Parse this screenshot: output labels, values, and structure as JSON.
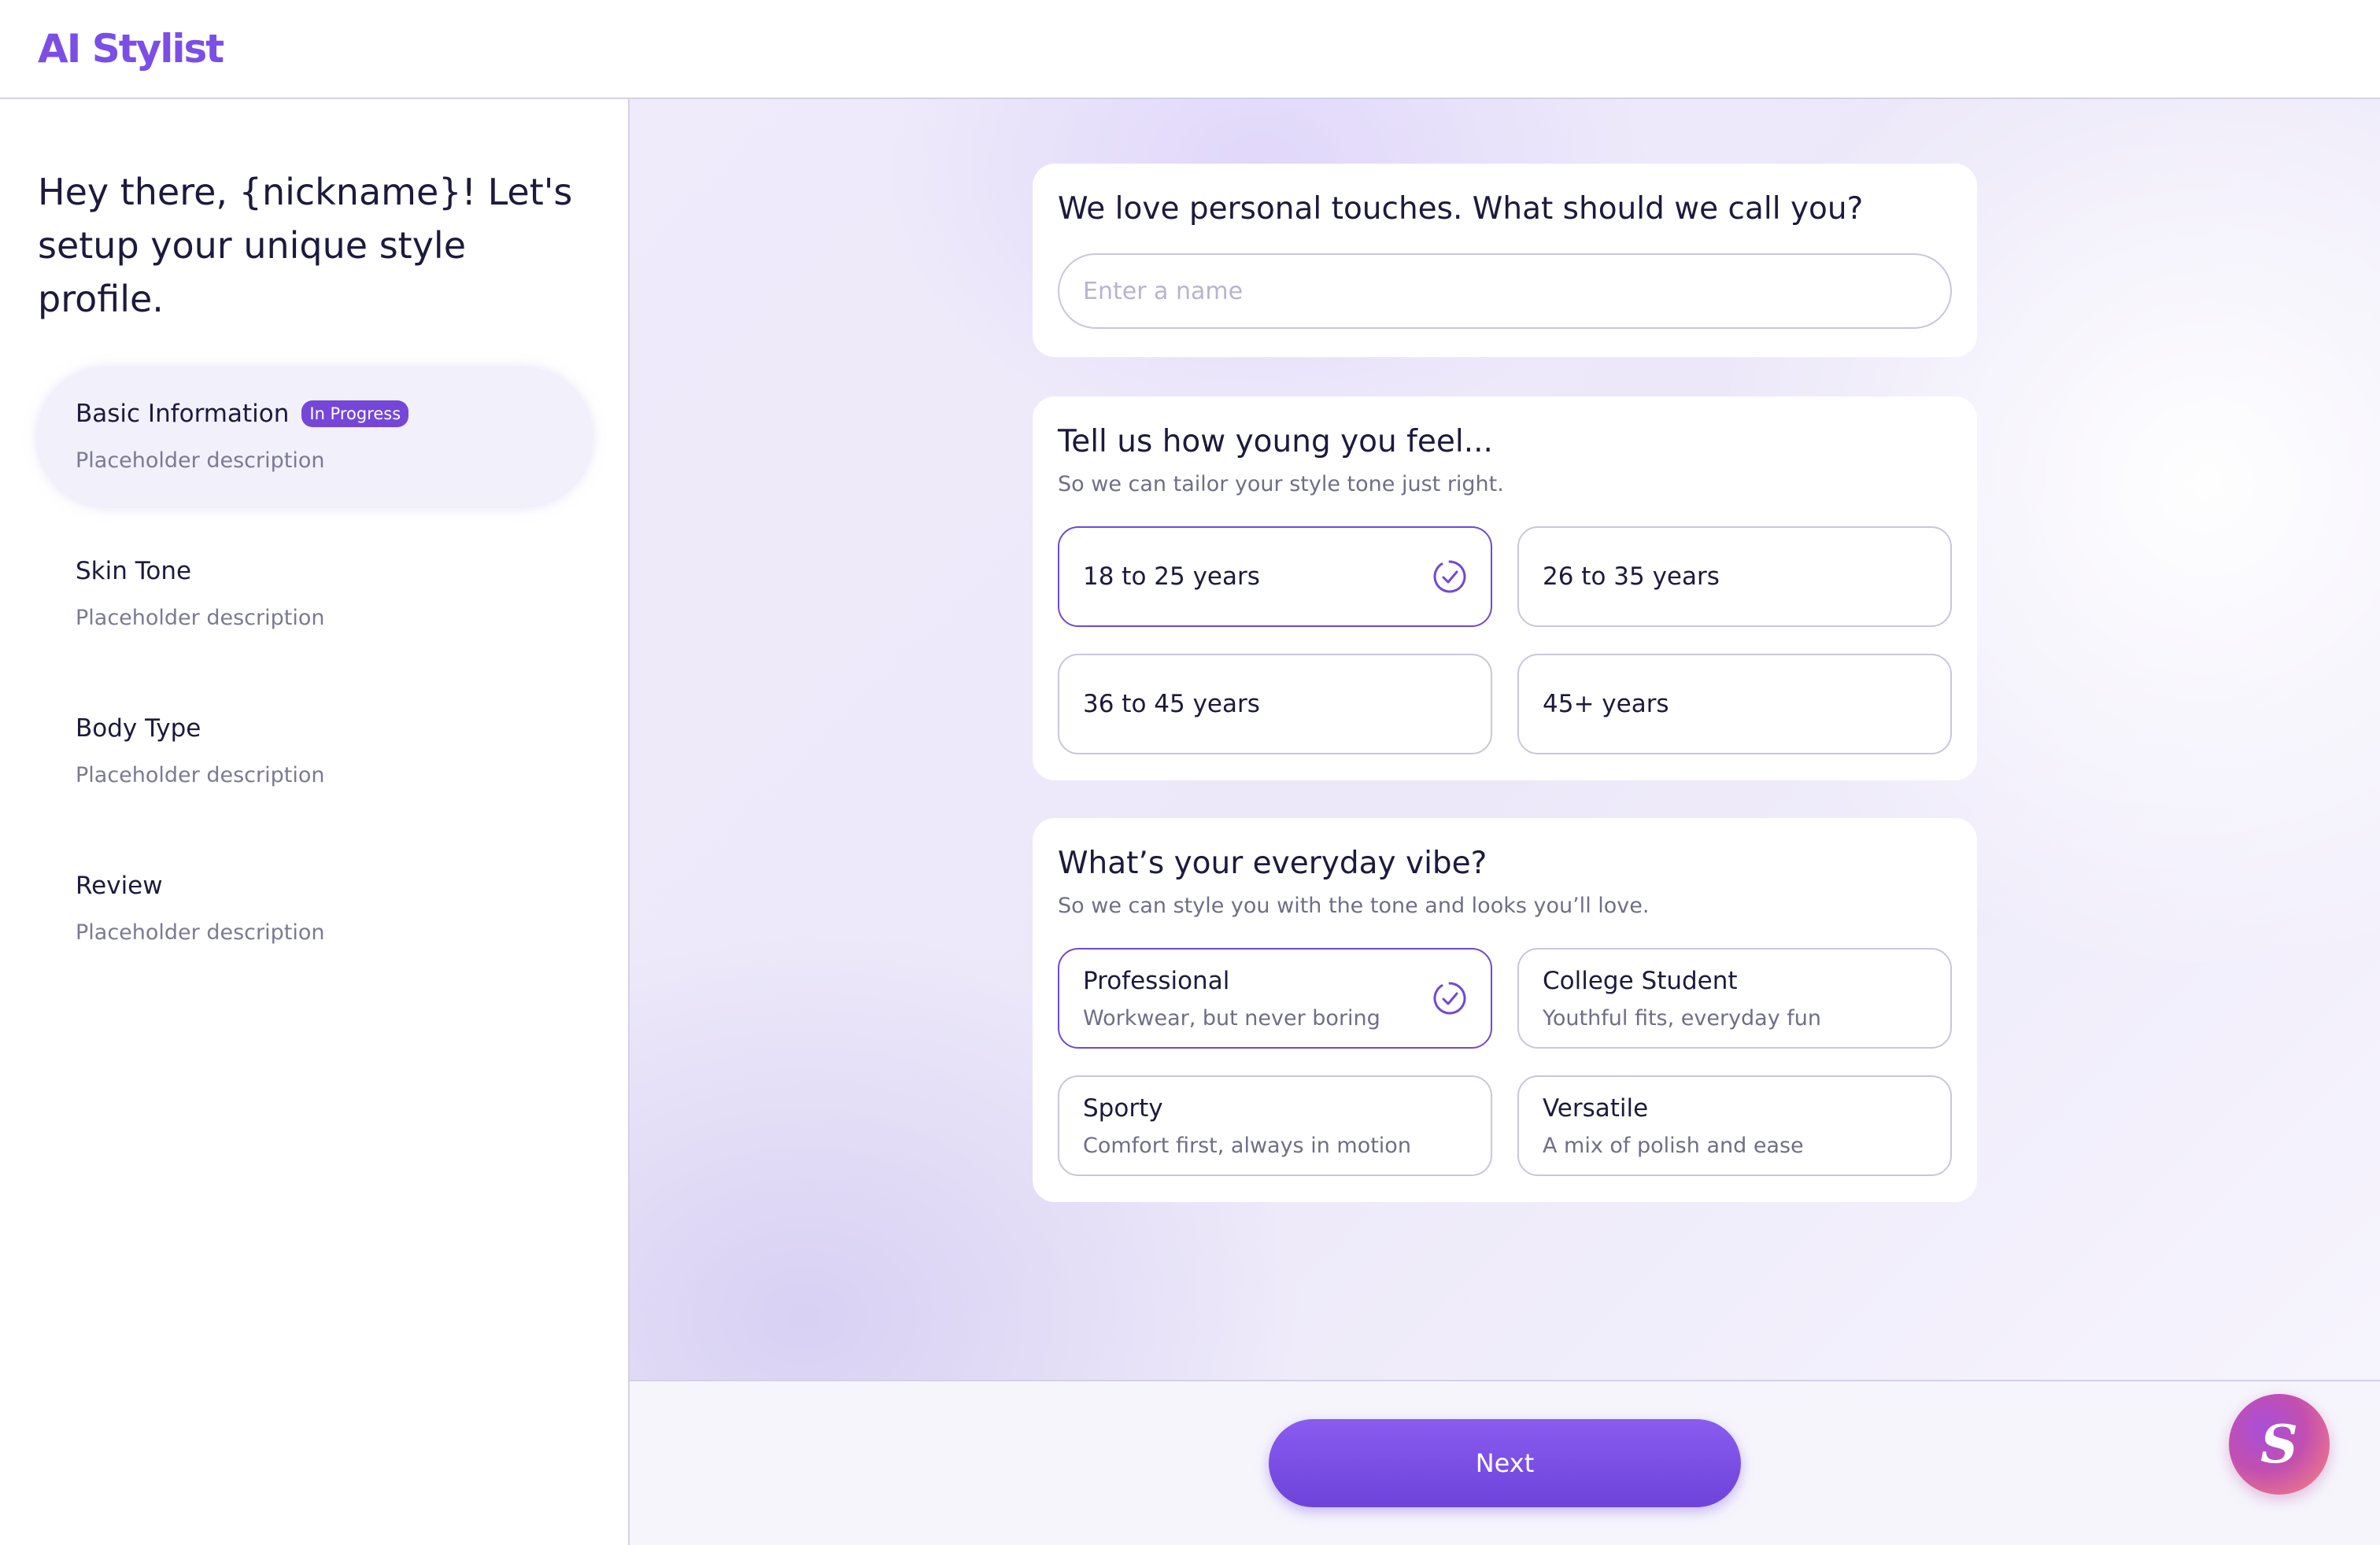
{
  "app": {
    "title": "AI Stylist"
  },
  "sidebar": {
    "greeting": "Hey there, {nickname}! Let's setup your unique style profile.",
    "steps": [
      {
        "title": "Basic Information",
        "badge": "In Progress",
        "description": "Placeholder description",
        "active": true
      },
      {
        "title": "Skin Tone",
        "description": "Placeholder description",
        "active": false
      },
      {
        "title": "Body Type",
        "description": "Placeholder description",
        "active": false
      },
      {
        "title": "Review",
        "description": "Placeholder description",
        "active": false
      }
    ]
  },
  "main": {
    "name_card": {
      "question": "We love personal touches. What should we call you?",
      "input_value": "",
      "input_placeholder": "Enter a name"
    },
    "age_card": {
      "question": "Tell us how young you feel...",
      "subtitle": "So we can tailor your style tone just right.",
      "options": [
        {
          "label": "18 to 25 years",
          "selected": true
        },
        {
          "label": "26 to 35 years",
          "selected": false
        },
        {
          "label": "36 to 45 years",
          "selected": false
        },
        {
          "label": "45+ years",
          "selected": false
        }
      ]
    },
    "vibe_card": {
      "question": "What’s your everyday vibe?",
      "subtitle": "So we can style you with the tone and looks you’ll love.",
      "options": [
        {
          "label": "Professional",
          "description": "Workwear, but never boring",
          "selected": true
        },
        {
          "label": "College Student",
          "description": "Youthful fits, everyday fun",
          "selected": false
        },
        {
          "label": "Sporty",
          "description": "Comfort first, always in motion",
          "selected": false
        },
        {
          "label": "Versatile",
          "description": "A mix of polish and ease",
          "selected": false
        }
      ]
    }
  },
  "footer": {
    "next_label": "Next",
    "assistant_glyph": "S"
  },
  "icons": {
    "check": "check-circle-icon",
    "assistant": "assistant-icon"
  },
  "colors": {
    "accent": "#7048d6",
    "logo": "#7b4ee6",
    "badge": "#7546d8",
    "text": "#1c1a3d",
    "muted": "#6f6e87"
  }
}
